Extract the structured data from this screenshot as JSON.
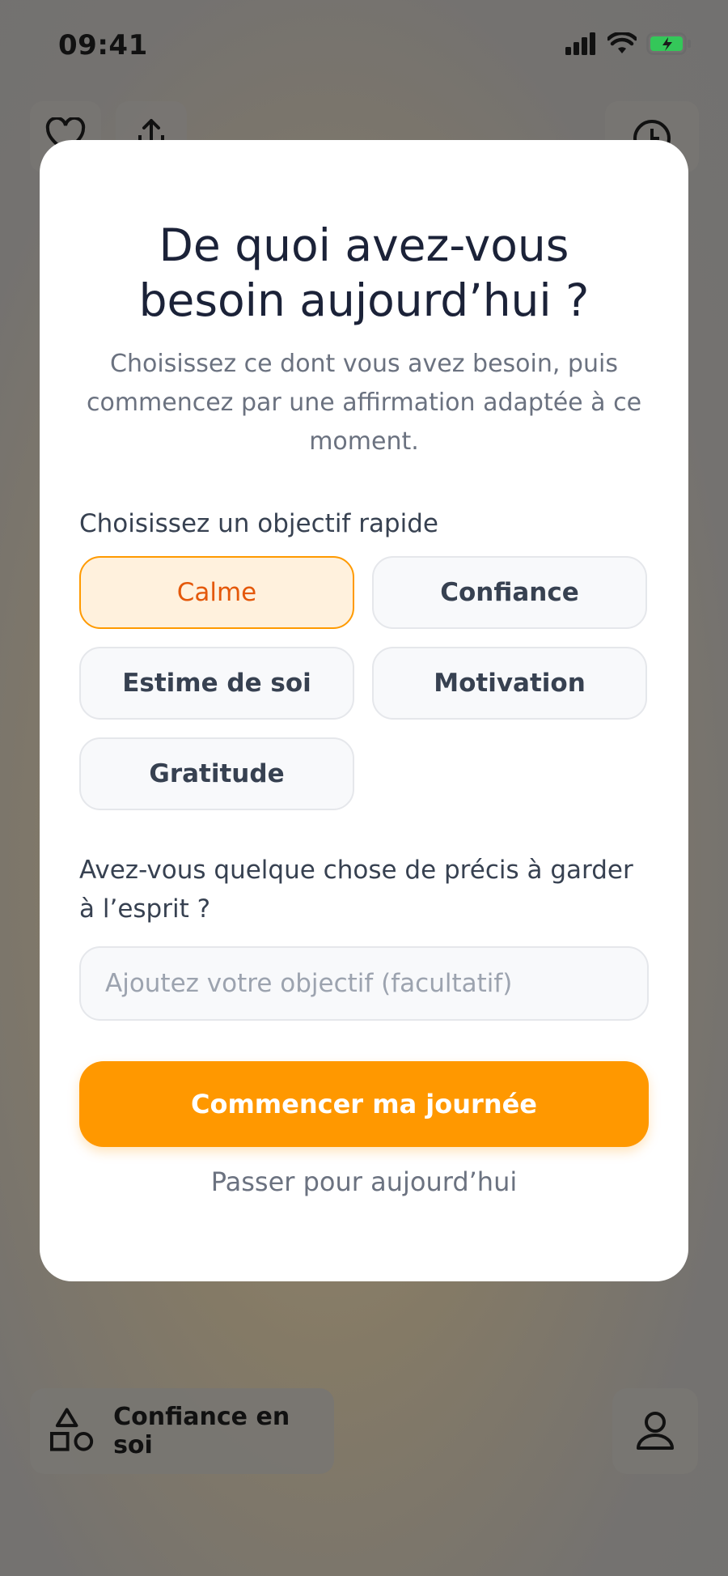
{
  "status_bar": {
    "time": "09:41"
  },
  "background": {
    "bottom_category_label": "Confiance en soi"
  },
  "modal": {
    "title": "De quoi avez-vous besoin aujourd’hui ?",
    "subtitle": "Choisissez ce dont vous avez besoin, puis commencez par une affirmation adaptée à ce moment.",
    "quick_goal_label": "Choisissez un objectif rapide",
    "goals": [
      {
        "label": "Calme",
        "selected": true
      },
      {
        "label": "Confiance",
        "selected": false
      },
      {
        "label": "Estime de soi",
        "selected": false
      },
      {
        "label": "Motivation",
        "selected": false
      },
      {
        "label": "Gratitude",
        "selected": false
      }
    ],
    "precise_label": "Avez-vous quelque chose de précis à garder à l’esprit ?",
    "input_placeholder": "Ajoutez votre objectif (facultatif)",
    "input_value": "",
    "start_button": "Commencer ma journée",
    "skip_link": "Passer pour aujourd’hui"
  },
  "colors": {
    "accent": "#ff9800",
    "selected_chip_bg": "#fff1dd",
    "selected_chip_text": "#e4580a",
    "title_text": "#1b2238"
  },
  "icons": [
    "heart-icon",
    "share-icon",
    "clock-icon",
    "shapes-icon",
    "profile-icon",
    "signal-icon",
    "wifi-icon",
    "battery-charging-icon"
  ]
}
